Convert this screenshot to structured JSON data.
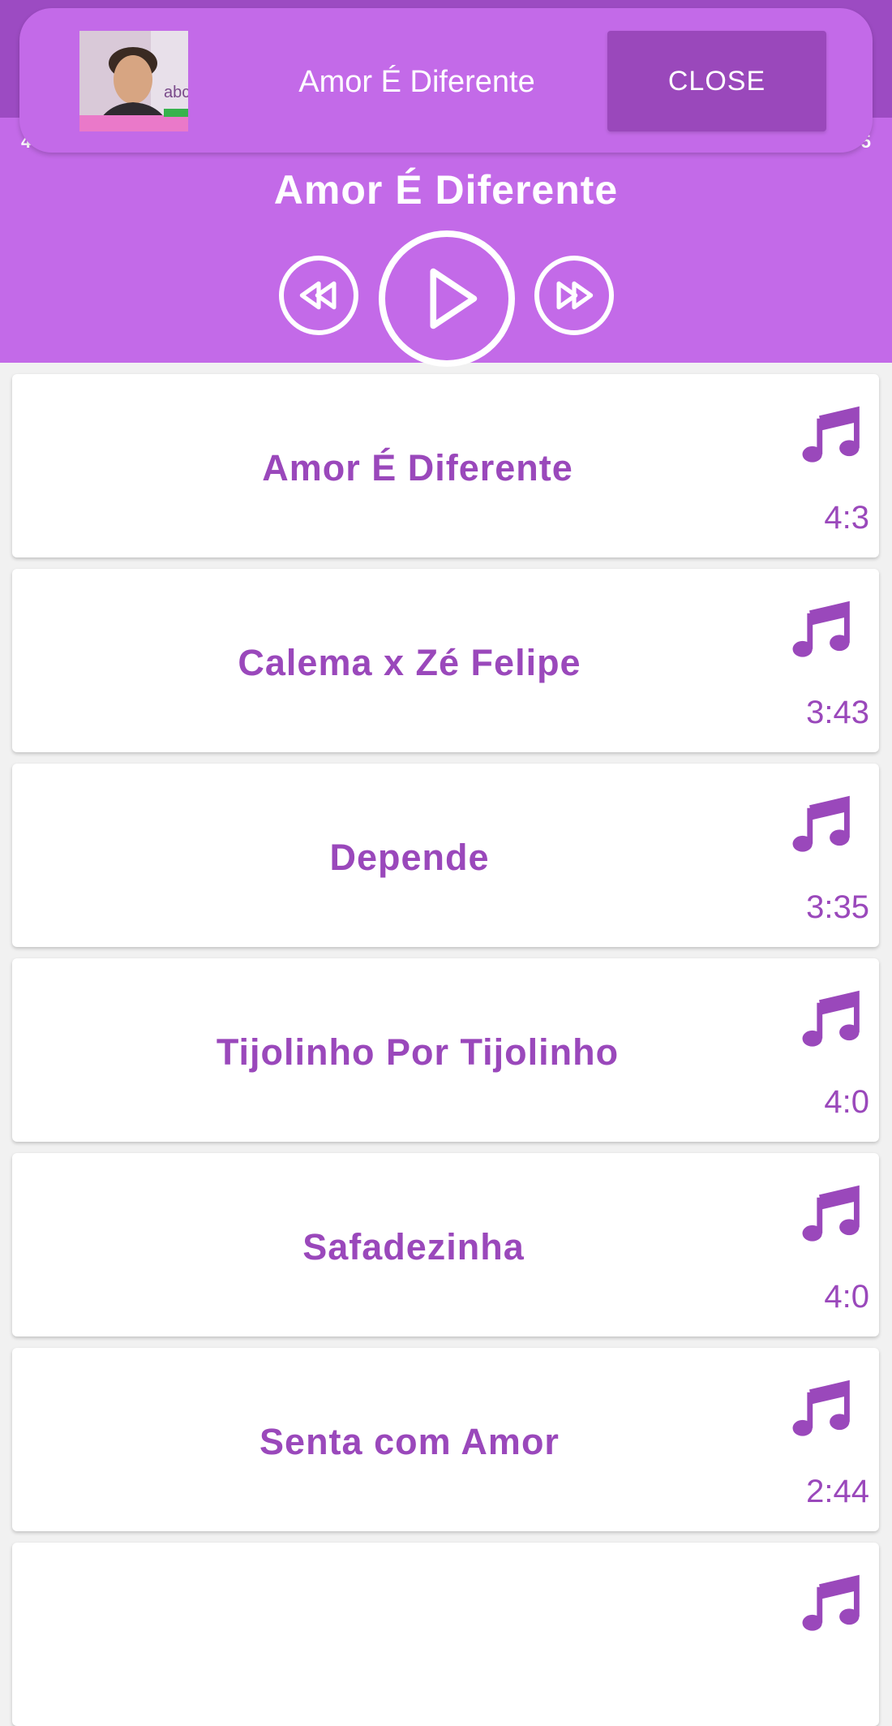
{
  "banner": {
    "thumb_name": "Zé Felipe",
    "title": "Amor É Diferente",
    "close_label": "CLOSE"
  },
  "player": {
    "title": "Amor É Diferente",
    "left_time_fragment": "4",
    "right_time_fragment": "5",
    "icons": {
      "prev": "rewind-icon",
      "play": "play-icon",
      "next": "fast-forward-icon"
    }
  },
  "songs": [
    {
      "title": "Amor É Diferente",
      "duration": "4:3"
    },
    {
      "title": "Calema x Zé Felipe",
      "duration": "3:43"
    },
    {
      "title": "Depende",
      "duration": "3:35"
    },
    {
      "title": "Tijolinho Por Tijolinho",
      "duration": "4:0"
    },
    {
      "title": "Safadezinha",
      "duration": "4:0"
    },
    {
      "title": "Senta com Amor",
      "duration": "2:44"
    },
    {
      "title": "",
      "duration": ""
    }
  ],
  "colors": {
    "app_bar": "#9c4bc2",
    "player_bg": "#c36ae8",
    "accent": "#9a48bb",
    "card_bg": "#ffffff",
    "page_bg": "#f1f1f1"
  }
}
